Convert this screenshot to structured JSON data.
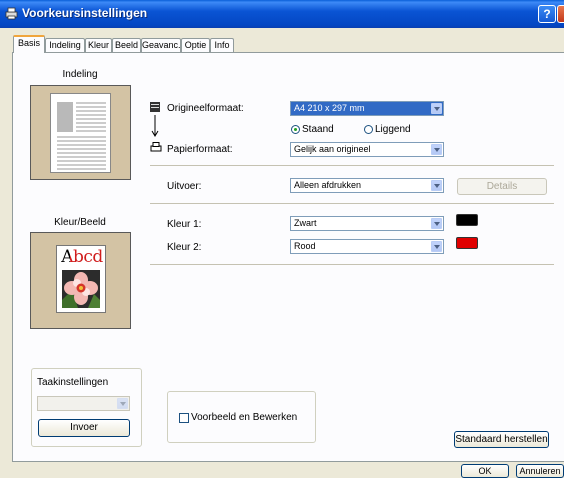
{
  "window": {
    "title": "Voorkeursinstellingen",
    "help": "?"
  },
  "tabs": [
    "Basis",
    "Indeling",
    "Kleur",
    "Beeld",
    "Geavanc.",
    "Optie",
    "Info"
  ],
  "active_tab": "Basis",
  "left": {
    "layout_title": "Indeling",
    "color_title": "Kleur/Beeld",
    "color_preview_text": "Abcd",
    "task_label": "Taakinstellingen",
    "task_combo_value": "",
    "import_button": "Invoer"
  },
  "form": {
    "original_label": "Origineelformaat:",
    "original_value": "A4 210 x 297 mm",
    "orientation_portrait": "Staand",
    "orientation_landscape": "Liggend",
    "orientation_selected": "Staand",
    "paper_label": "Papierformaat:",
    "paper_value": "Gelijk aan origineel",
    "output_label": "Uitvoer:",
    "output_value": "Alleen afdrukken",
    "details_button": "Details",
    "color1_label": "Kleur 1:",
    "color1_value": "Zwart",
    "color1_hex": "#000000",
    "color2_label": "Kleur 2:",
    "color2_value": "Rood",
    "color2_hex": "#e00000",
    "preview_edit_label": "Voorbeeld en Bewerken",
    "restore_button": "Standaard herstellen"
  },
  "footer": {
    "ok": "OK",
    "cancel": "Annuleren"
  }
}
